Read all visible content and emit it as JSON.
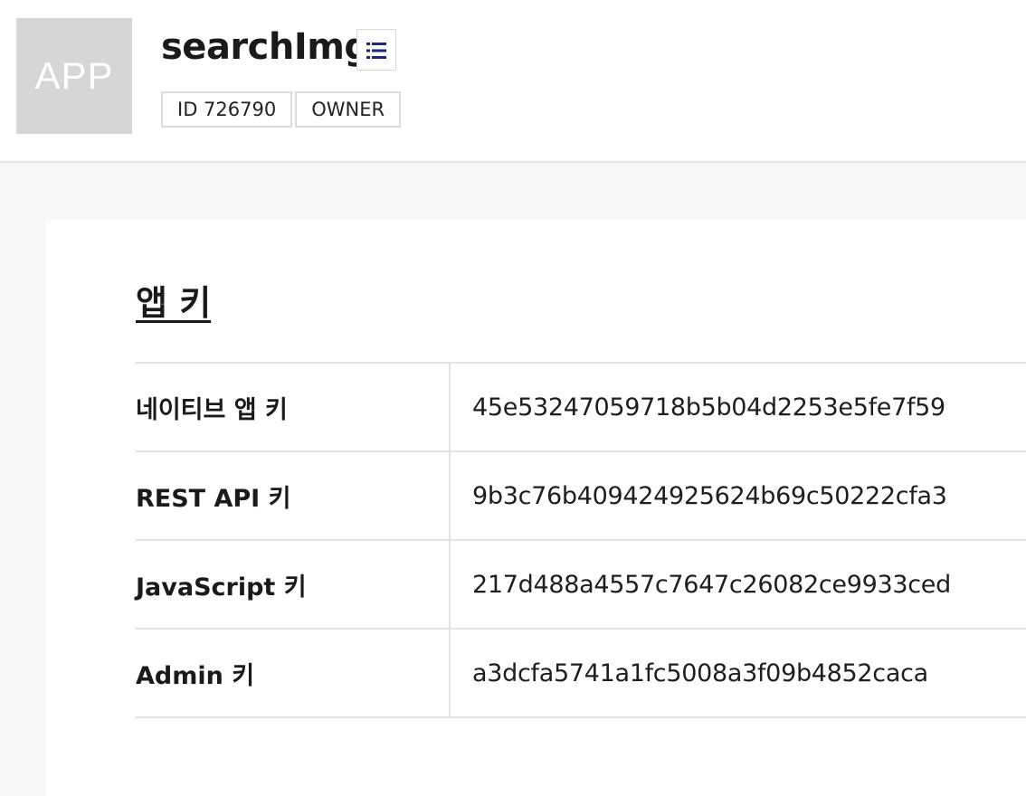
{
  "app": {
    "thumbnail_text": "APP",
    "name": "searchImg",
    "menu_icon": "list-icon",
    "id_tag": "ID 726790",
    "role_tag": "OWNER"
  },
  "section": {
    "title": "앱 키"
  },
  "keys": [
    {
      "label": "네이티브 앱 키",
      "value": "45e53247059718b5b04d2253e5fe7f59"
    },
    {
      "label": "REST API 키",
      "value": "9b3c76b409424925624b69c50222cfa3"
    },
    {
      "label": "JavaScript 키",
      "value": "217d488a4557c7647c26082ce9933ced"
    },
    {
      "label": "Admin 키",
      "value": "a3dcfa5741a1fc5008a3f09b4852caca"
    }
  ],
  "colors": {
    "menu_icon": "#1b2a7a",
    "thumbnail_bg": "#d6d6d6",
    "page_bg": "#f6f7f7"
  }
}
